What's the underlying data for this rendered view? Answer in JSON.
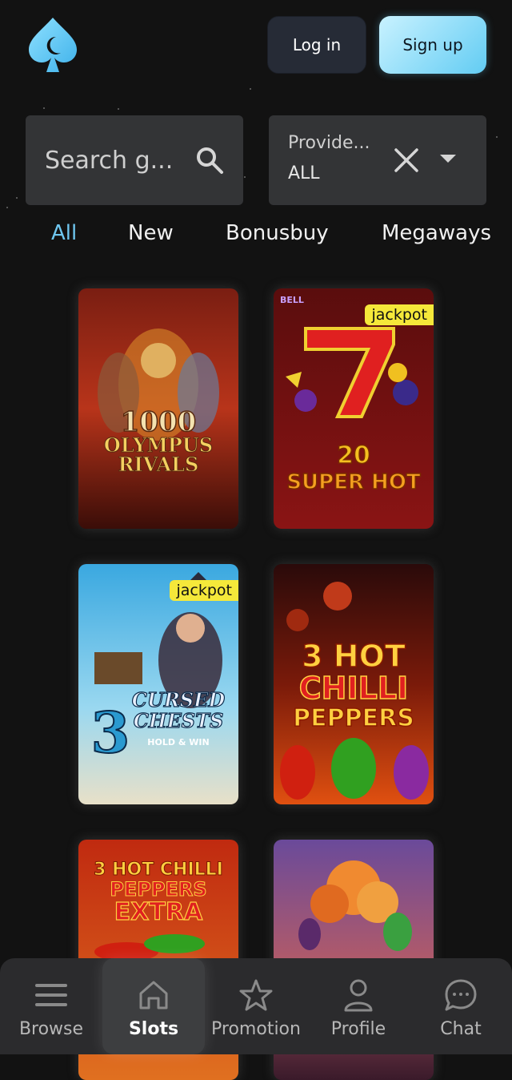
{
  "header": {
    "login_label": "Log in",
    "signup_label": "Sign up",
    "brand_color": "#6fc7f0"
  },
  "search": {
    "placeholder": "Search g..."
  },
  "provider": {
    "label": "Provide...",
    "value": "ALL"
  },
  "tabs": [
    {
      "label": "All",
      "active": true
    },
    {
      "label": "New",
      "active": false
    },
    {
      "label": "Bonusbuy",
      "active": false
    },
    {
      "label": "Megaways",
      "active": false
    }
  ],
  "games": [
    {
      "title_line1": "1000",
      "title_line2": "OLYMPUS",
      "title_line3": "RIVALS",
      "badge": ""
    },
    {
      "title_line1": "20",
      "title_line2": "SUPER HOT",
      "badge": "jackpot",
      "provider_mark": "BELL"
    },
    {
      "title_line1": "3",
      "title_line2": "CURSED",
      "title_line3": "CHESTS",
      "subtitle": "HOLD & WIN",
      "badge": "jackpot"
    },
    {
      "title_line1": "3 HOT",
      "title_line2": "CHILLI",
      "title_line3": "PEPPERS",
      "badge": ""
    },
    {
      "title_line1": "3 HOT CHILLI",
      "title_line2": "PEPPERS",
      "title_line3": "EXTRA",
      "badge": ""
    },
    {
      "badge": ""
    }
  ],
  "nav": [
    {
      "label": "Browse",
      "icon": "menu-icon",
      "active": false
    },
    {
      "label": "Slots",
      "icon": "slots-icon",
      "active": true
    },
    {
      "label": "Promotion",
      "icon": "star-icon",
      "active": false
    },
    {
      "label": "Profile",
      "icon": "user-icon",
      "active": false
    },
    {
      "label": "Chat",
      "icon": "chat-icon",
      "active": false
    }
  ]
}
